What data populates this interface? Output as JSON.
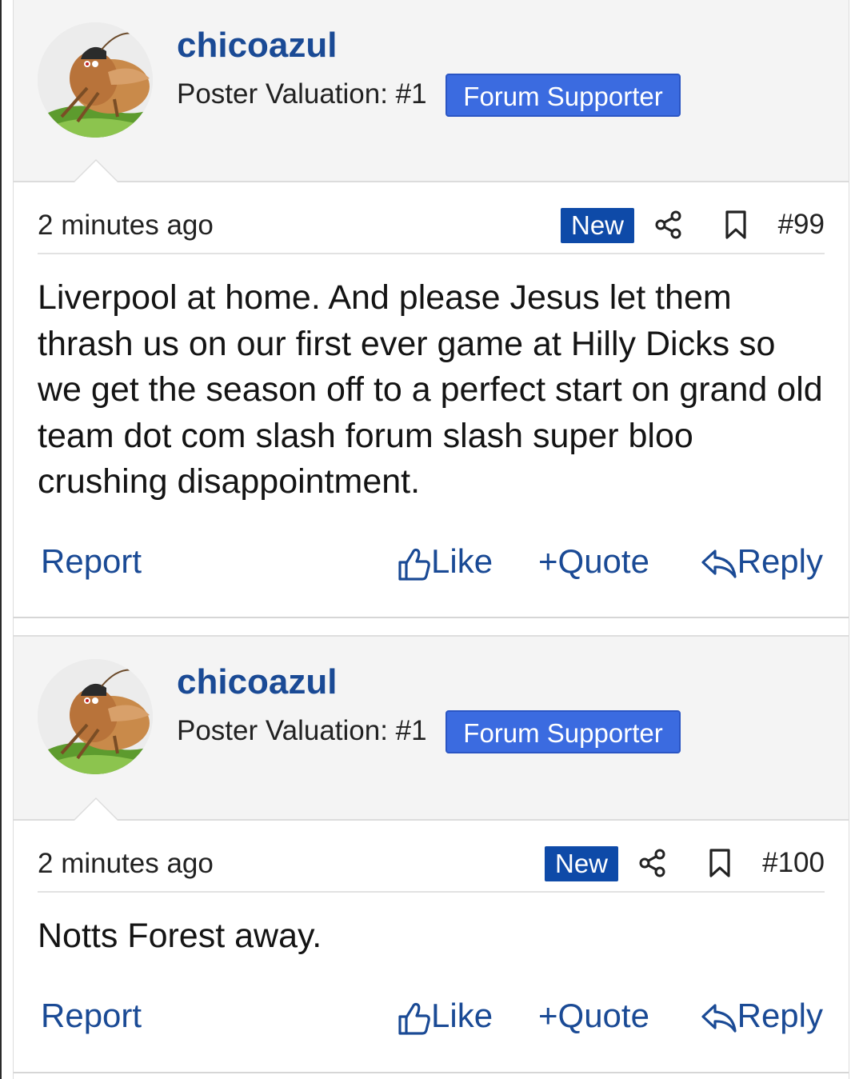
{
  "posts": [
    {
      "username": "chicoazul",
      "valuation": "Poster Valuation: #1",
      "badge": "Forum Supporter",
      "time": "2 minutes ago",
      "new_label": "New",
      "post_number": "#99",
      "body": "Liverpool at home. And please Jesus let them thrash us on our first ever game at Hilly Dicks so we get the season off to a perfect start on grand old team dot com slash forum slash super bloo crushing disappointment.",
      "actions": {
        "report": "Report",
        "like": "Like",
        "quote": "Quote",
        "reply": "Reply"
      }
    },
    {
      "username": "chicoazul",
      "valuation": "Poster Valuation: #1",
      "badge": "Forum Supporter",
      "time": "2 minutes ago",
      "new_label": "New",
      "post_number": "#100",
      "body": "Notts Forest away.",
      "actions": {
        "report": "Report",
        "like": "Like",
        "quote": "Quote",
        "reply": "Reply"
      }
    }
  ],
  "icons": {
    "share": "share-icon",
    "bookmark": "bookmark-icon",
    "like": "thumbs-up-icon",
    "quote": "plus-icon",
    "reply": "reply-arrow-icon"
  },
  "colors": {
    "link": "#1a4a95",
    "badge": "#3b6be0",
    "new": "#0e4aa8",
    "header_bg": "#f4f4f4"
  }
}
